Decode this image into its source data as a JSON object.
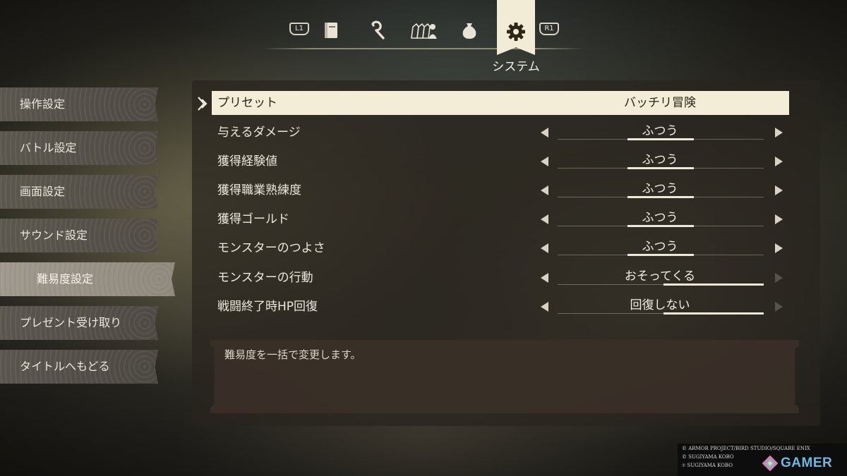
{
  "tabbar": {
    "left_button": "L1",
    "right_button": "R1",
    "tabs": [
      {
        "icon": "book-icon"
      },
      {
        "icon": "magic-staff-icon"
      },
      {
        "icon": "party-icon"
      },
      {
        "icon": "bag-icon"
      },
      {
        "icon": "gear-icon"
      }
    ],
    "active_label": "システム"
  },
  "sidebar": {
    "items": [
      {
        "label": "操作設定"
      },
      {
        "label": "バトル設定"
      },
      {
        "label": "画面設定"
      },
      {
        "label": "サウンド設定"
      },
      {
        "label": "難易度設定"
      },
      {
        "label": "プレゼント受け取り"
      },
      {
        "label": "タイトルへもどる"
      }
    ]
  },
  "settings": {
    "preset": {
      "label": "プリセット",
      "value": "バッチリ冒険"
    },
    "rows": [
      {
        "label": "与えるダメージ",
        "value": "ふつう",
        "level": 0.5
      },
      {
        "label": "獲得経験値",
        "value": "ふつう",
        "level": 0.5
      },
      {
        "label": "獲得職業熟練度",
        "value": "ふつう",
        "level": 0.5
      },
      {
        "label": "獲得ゴールド",
        "value": "ふつう",
        "level": 0.5
      },
      {
        "label": "モンスターのつよさ",
        "value": "ふつう",
        "level": 0.5
      },
      {
        "label": "モンスターの行動",
        "value": "おそってくる",
        "level": 1.0
      },
      {
        "label": "戦闘終了時HP回復",
        "value": "回復しない",
        "level": 1.0
      }
    ]
  },
  "description": {
    "text": "難易度を一括で変更します。"
  },
  "credits": {
    "lines": [
      "© ARMOR PROJECT/BIRD STUDIO/SQUARE ENIX",
      "© SUGIYAMA KOBO",
      "℗ SUGIYAMA KOBO"
    ],
    "logo_text": "GAMER"
  },
  "colors": {
    "highlight": "#f3ecd6",
    "panel": "#28241e",
    "logo": "#6fb7e0"
  }
}
